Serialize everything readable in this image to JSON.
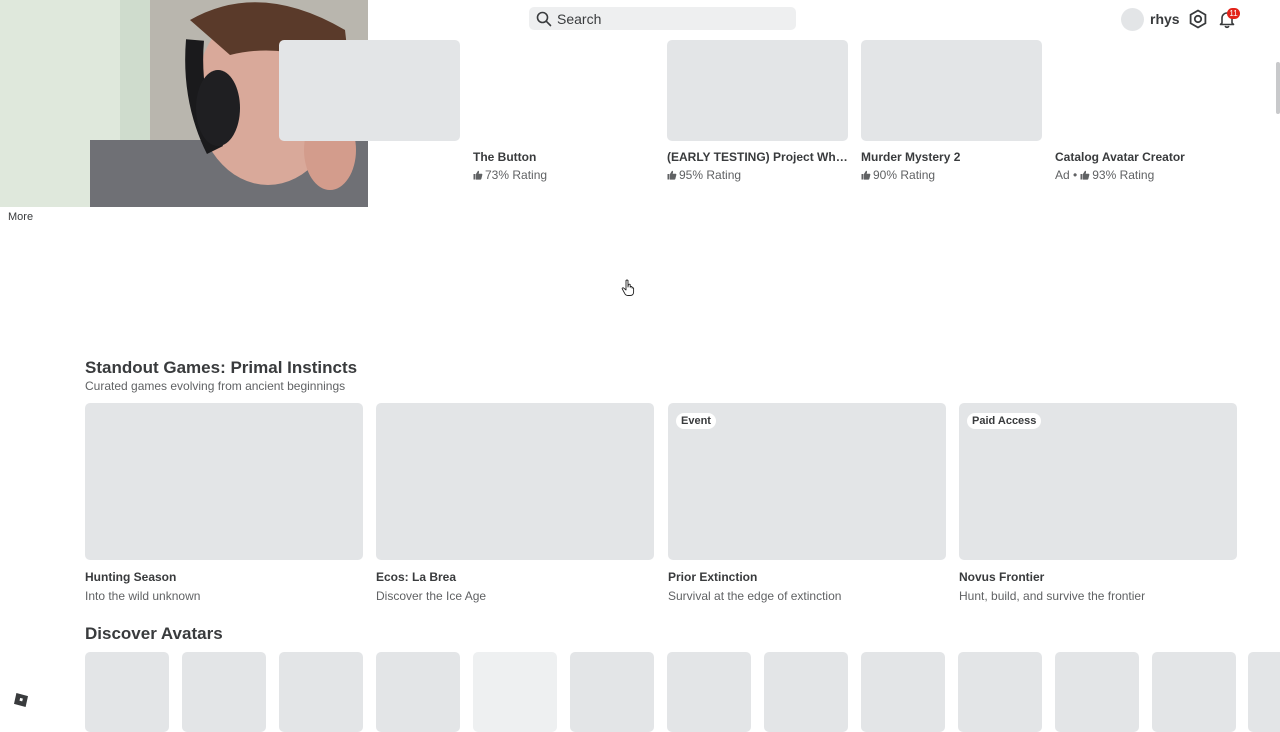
{
  "header": {
    "search_placeholder": "Search",
    "username": "rhys",
    "notification_count": "11"
  },
  "sidebar": {
    "more_label": "More"
  },
  "top_row": [
    {
      "title": "",
      "meta_prefix": "",
      "rating": ""
    },
    {
      "title": "The Button",
      "meta_prefix": "",
      "rating": "73% Rating"
    },
    {
      "title": "(EARLY TESTING) Project Wheel...",
      "meta_prefix": "",
      "rating": "95% Rating"
    },
    {
      "title": "Murder Mystery 2",
      "meta_prefix": "",
      "rating": "90% Rating"
    },
    {
      "title": "Catalog Avatar Creator",
      "meta_prefix": "Ad •",
      "rating": "93% Rating"
    }
  ],
  "standout": {
    "title": "Standout Games: Primal Instincts",
    "subtitle": "Curated games evolving from ancient beginnings",
    "games": [
      {
        "title": "Hunting Season",
        "desc": "Into the wild unknown",
        "badge": ""
      },
      {
        "title": "Ecos: La Brea",
        "desc": "Discover the Ice Age",
        "badge": ""
      },
      {
        "title": "Prior Extinction",
        "desc": "Survival at the edge of extinction",
        "badge": "Event"
      },
      {
        "title": "Novus Frontier",
        "desc": "Hunt, build, and survive the frontier",
        "badge": "Paid Access"
      }
    ]
  },
  "avatars": {
    "title": "Discover Avatars"
  },
  "colors": {
    "placeholder": "#e3e5e7",
    "notification_badge": "#e2231a",
    "text_primary": "#393b3d",
    "text_secondary": "#606264"
  }
}
